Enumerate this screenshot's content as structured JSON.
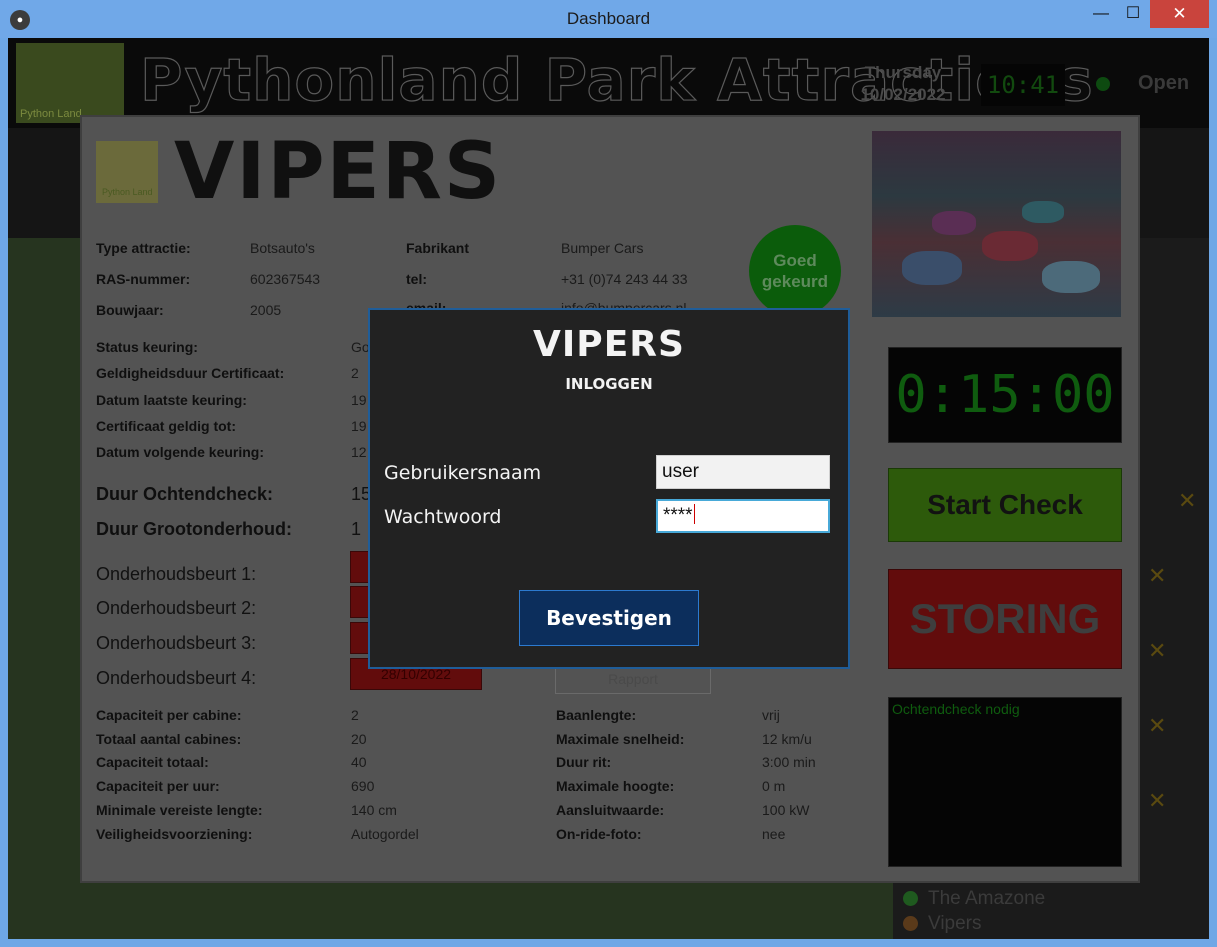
{
  "window": {
    "title": "Dashboard",
    "min": "—",
    "max": "☐",
    "close": "✕"
  },
  "background": {
    "logo_text": "Python Land",
    "park_title": "Pythonland Park Attractions",
    "day": "Thursday",
    "date": "10/02/2022",
    "clock": "10:41",
    "status": "Open",
    "list": [
      "The Amazone",
      "Vipers"
    ]
  },
  "attraction": {
    "logo_text": "Python Land",
    "name": "VIPERS",
    "left_info": [
      {
        "label": "Type attractie:",
        "value": "Botsauto's"
      },
      {
        "label": "RAS-nummer:",
        "value": "602367543"
      },
      {
        "label": "Bouwjaar:",
        "value": "2005"
      }
    ],
    "right_info": [
      {
        "label": "Fabrikant",
        "value": "Bumper Cars"
      },
      {
        "label": "tel:",
        "value": "+31 (0)74 243 44 33"
      },
      {
        "label": "email:",
        "value": "info@bumpercars.nl"
      }
    ],
    "inspection": [
      {
        "label": "Status keuring:",
        "value": "Go"
      },
      {
        "label": "Geldigheidsduur Certificaat:",
        "value": "2"
      },
      {
        "label": "Datum laatste keuring:",
        "value": "19"
      },
      {
        "label": "Certificaat geldig tot:",
        "value": "19"
      },
      {
        "label": "Datum volgende keuring:",
        "value": "12"
      }
    ],
    "durations": [
      {
        "label": "Duur Ochtendcheck:",
        "value": "15"
      },
      {
        "label": "Duur Grootonderhoud:",
        "value": "1"
      }
    ],
    "maintenance": [
      {
        "label": "Onderhoudsbeurt 1:",
        "date": ""
      },
      {
        "label": "Onderhoudsbeurt 2:",
        "date": ""
      },
      {
        "label": "Onderhoudsbeurt 3:",
        "date": ""
      },
      {
        "label": "Onderhoudsbeurt 4:",
        "date": "28/10/2022"
      }
    ],
    "rapport_label": "Rapport",
    "badge": "Goed gekeurd",
    "specs_left": [
      {
        "label": "Capaciteit per cabine:",
        "value": "2"
      },
      {
        "label": "Totaal aantal cabines:",
        "value": "20"
      },
      {
        "label": "Capaciteit totaal:",
        "value": "40"
      },
      {
        "label": "Capaciteit per uur:",
        "value": "690"
      },
      {
        "label": "Minimale vereiste lengte:",
        "value": "140 cm"
      },
      {
        "label": "Veiligheidsvoorziening:",
        "value": "Autogordel"
      }
    ],
    "specs_right": [
      {
        "label": "Baanlengte:",
        "value": "vrij"
      },
      {
        "label": "Maximale snelheid:",
        "value": "12 km/u"
      },
      {
        "label": "Duur rit:",
        "value": "3:00 min"
      },
      {
        "label": "Maximale hoogte:",
        "value": "0 m"
      },
      {
        "label": "Aansluitwaarde:",
        "value": "100 kW"
      },
      {
        "label": "On-ride-foto:",
        "value": "nee"
      }
    ],
    "timer": "0:15:00",
    "start_check": "Start Check",
    "storing": "STORING",
    "log_text": "Ochtendcheck nodig"
  },
  "login": {
    "title": "VIPERS",
    "subtitle": "INLOGGEN",
    "username_label": "Gebruikersnaam",
    "username_value": "user",
    "password_label": "Wachtwoord",
    "password_value": "****",
    "submit": "Bevestigen"
  },
  "colors": {
    "modal_border": "#1f5d99",
    "button_bg": "#0c2e5c",
    "focus_border": "#48a9d8"
  }
}
